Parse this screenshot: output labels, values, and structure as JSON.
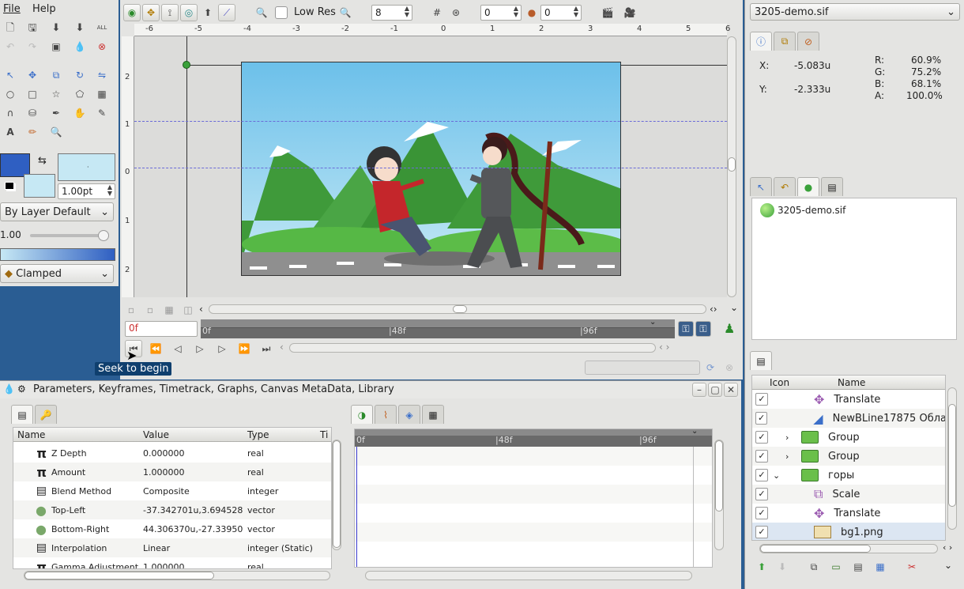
{
  "menu": {
    "file": "File",
    "help": "Help"
  },
  "toolbox": {
    "fill_outline_values": {
      "width": "1.00pt",
      "blend": "By Layer Default",
      "opacity": "1.00",
      "interpolation": "Clamped"
    }
  },
  "canvas_toolbar": {
    "low_res_label": "Low Res",
    "quality_value": "8",
    "onion_past": "0",
    "onion_future": "0"
  },
  "ruler": {
    "h_ticks": [
      "-6",
      "-5",
      "-4",
      "-3",
      "-2",
      "-1",
      "0",
      "1",
      "2",
      "3",
      "4",
      "5",
      "6"
    ],
    "v_ticks": [
      "2",
      "1",
      "0",
      "1",
      "2"
    ]
  },
  "timebar": {
    "current_time": "0f",
    "marks": [
      "0f",
      "|48f",
      "|96f"
    ]
  },
  "tooltip": "Seek to begin",
  "params_panel": {
    "title": "Parameters, Keyframes, Timetrack, Graphs, Canvas MetaData, Library",
    "columns": [
      "Name",
      "Value",
      "Type",
      "Ti"
    ],
    "rows": [
      {
        "icon": "π",
        "name": "Z Depth",
        "value": "0.000000",
        "type": "real"
      },
      {
        "icon": "π",
        "name": "Amount",
        "value": "1.000000",
        "type": "real"
      },
      {
        "icon": "▤",
        "name": "Blend Method",
        "value": "Composite",
        "type": "integer"
      },
      {
        "icon": "●",
        "name": "Top-Left",
        "value": "-37.342701u,3.694528",
        "type": "vector"
      },
      {
        "icon": "●",
        "name": "Bottom-Right",
        "value": "44.306370u,-27.33950",
        "type": "vector"
      },
      {
        "icon": "▤",
        "name": "Interpolation",
        "value": "Linear",
        "type": "integer (Static)"
      },
      {
        "icon": "π",
        "name": "Gamma Adjustment",
        "value": "1.000000",
        "type": "real"
      }
    ]
  },
  "timetrack": {
    "marks": [
      "0f",
      "|48f",
      "|96f"
    ]
  },
  "right_panel": {
    "file_selector": "3205-demo.sif",
    "info": {
      "x_label": "X:",
      "x_value": "-5.083u",
      "y_label": "Y:",
      "y_value": "-2.333u",
      "r_label": "R:",
      "r_value": "60.9%",
      "g_label": "G:",
      "g_value": "75.2%",
      "b_label": "B:",
      "b_value": "68.1%",
      "a_label": "A:",
      "a_value": "100.0%"
    },
    "canvas_browser_item": "3205-demo.sif",
    "layers": {
      "columns": [
        "Icon",
        "Name"
      ],
      "rows": [
        {
          "name": "Translate",
          "icon": "translate-icon",
          "indent": 1
        },
        {
          "name": "NewBLine17875 Обла",
          "icon": "region-icon",
          "indent": 1
        },
        {
          "name": "Group",
          "icon": "folder-icon",
          "indent": 0,
          "expander": "›"
        },
        {
          "name": "Group",
          "icon": "folder-icon",
          "indent": 0,
          "expander": "›"
        },
        {
          "name": "горы",
          "icon": "folder-icon",
          "indent": 0,
          "expander": "⌄"
        },
        {
          "name": "Scale",
          "icon": "scale-icon",
          "indent": 1
        },
        {
          "name": "Translate",
          "icon": "translate-icon",
          "indent": 1
        },
        {
          "name": "bg1.png",
          "icon": "image-icon",
          "indent": 1
        }
      ]
    }
  },
  "colors": {
    "outline": "#2f5fc2",
    "fill": "#c6e8f4",
    "sky": "#8ccde8",
    "mountain": "#3f9a3a",
    "road": "#8f8f8f"
  }
}
